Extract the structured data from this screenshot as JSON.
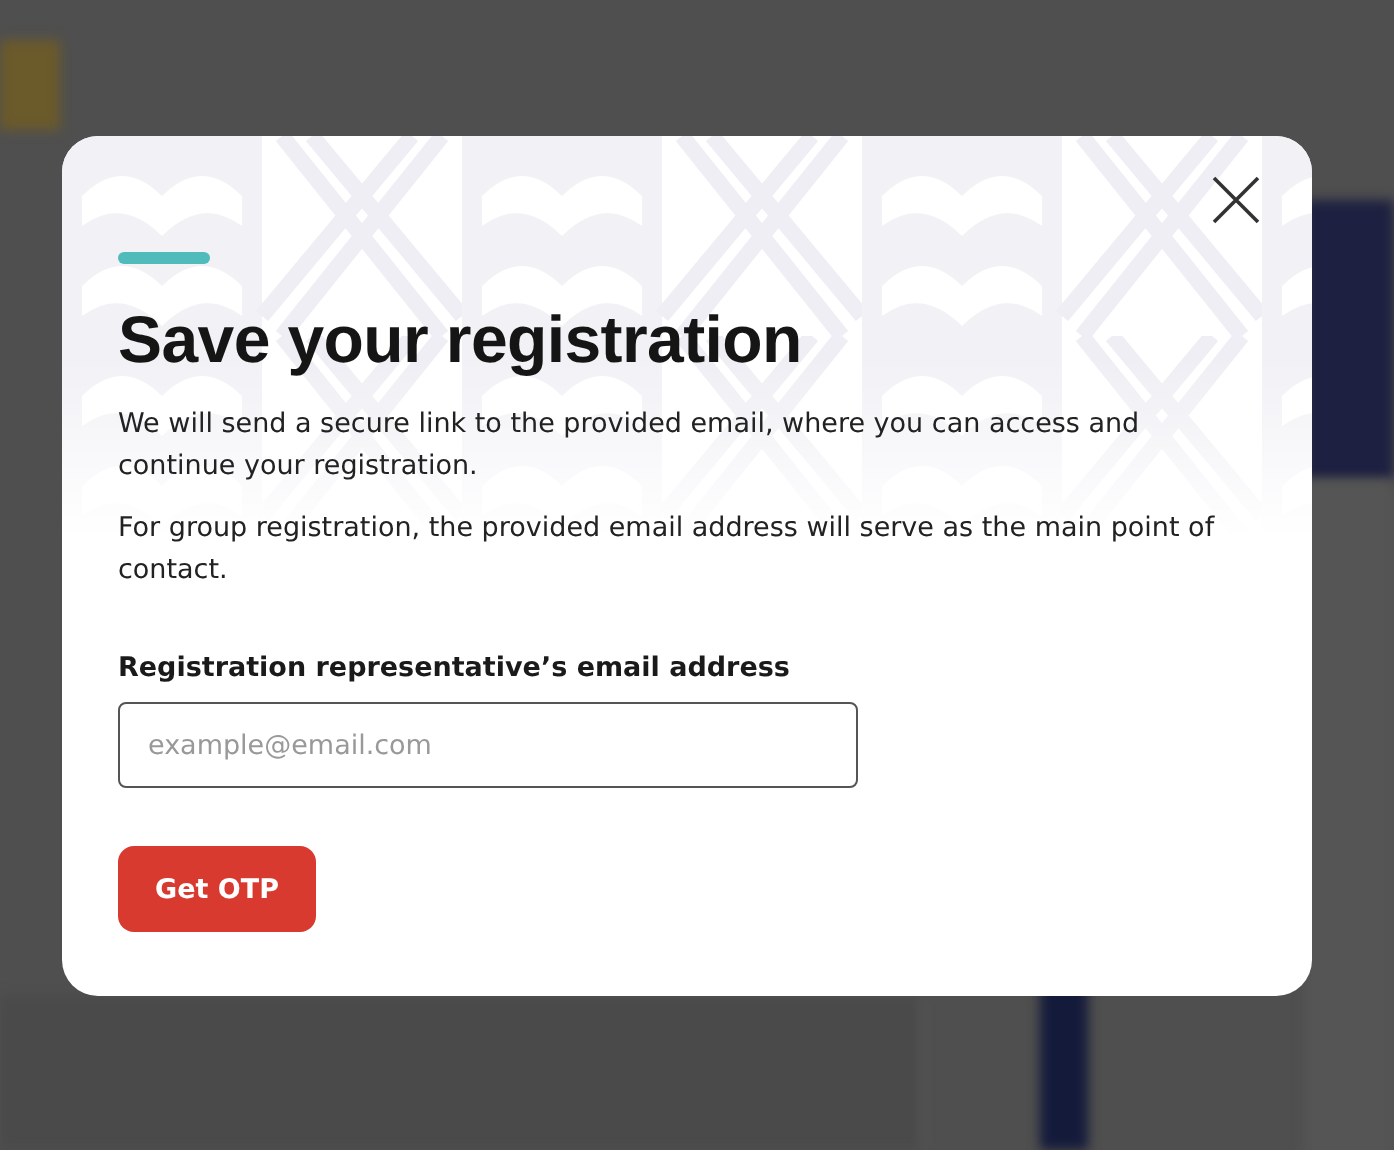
{
  "dialog": {
    "title": "Save your registration",
    "paragraphs": [
      "We will send a secure link to the provided email, where you can access and continue your registration.",
      "For group registration, the provided email address will serve as the main point of contact."
    ],
    "email_field": {
      "label": "Registration representative’s email address",
      "placeholder": "example@email.com"
    },
    "button": "Get OTP"
  }
}
